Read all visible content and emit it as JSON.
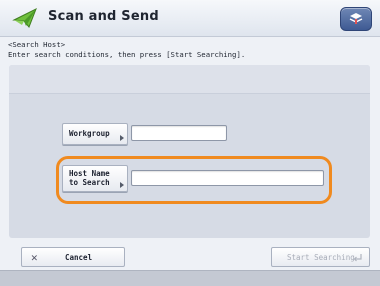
{
  "header": {
    "title": "Scan and Send",
    "app_icon": "paper-plane-icon",
    "menu_icon": "stack-menu-icon"
  },
  "instructions": {
    "line1": "<Search Host>",
    "line2": "Enter search conditions, then press [Start Searching]."
  },
  "fields": {
    "workgroup": {
      "label": "Workgroup",
      "value": ""
    },
    "host_name": {
      "label_line1": "Host Name",
      "label_line2": "to Search",
      "value": ""
    }
  },
  "footer": {
    "cancel_label": "Cancel",
    "cancel_icon": "close-x-icon",
    "start_label": "Start Searching",
    "start_icon": "enter-icon",
    "start_enabled": false
  },
  "colors": {
    "highlight": "#f08a1f",
    "accent": "#3e5a93",
    "app_icon_green": "#5aa832"
  }
}
